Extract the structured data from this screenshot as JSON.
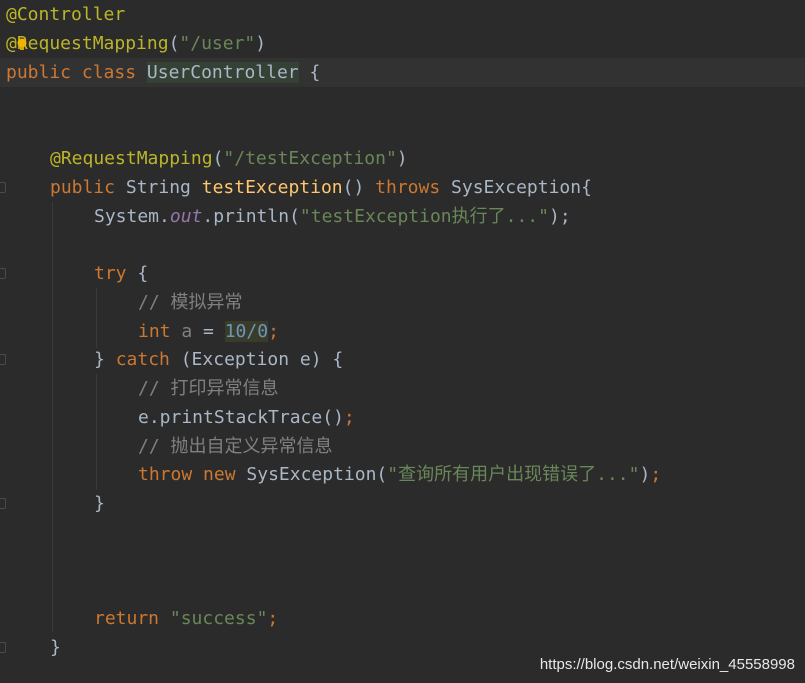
{
  "code": {
    "annotation_controller": "@Controller",
    "annotation_request_mapping_class": "@RequestMapping",
    "class_mapping_value": "\"/user\"",
    "kw_public": "public",
    "kw_class": "class",
    "class_name": "UserController",
    "open_brace": "{",
    "method_annotation": "@RequestMapping",
    "method_mapping_value": "\"/testException\"",
    "type_string": "String",
    "method_name": "testException",
    "method_parens": "()",
    "kw_throws": "throws",
    "exception_type_decl": "SysException{",
    "system_prefix": "System.",
    "field_out": "out",
    "println_call": ".println(",
    "println_string": "\"testException执行了...\"",
    "close_paren_semi": ");",
    "kw_try": "try",
    "comment_simulate": "// 模拟异常",
    "kw_int": "int",
    "var_a": "a",
    "assign": " = ",
    "div_expr": "10/0",
    "semicolon": ";",
    "close_brace": "}",
    "kw_catch": "catch",
    "catch_params": "(Exception e) {",
    "comment_print": "// 打印异常信息",
    "print_stack_trace": "e.printStackTrace()",
    "comment_throw": "// 抛出自定义异常信息",
    "kw_throw": "throw",
    "kw_new": "new",
    "sys_exception_ctor": "SysException(",
    "throw_message": "\"查询所有用户出现错误了...\"",
    "kw_return": "return",
    "return_value": "\"success\"",
    "method_close_brace": "}"
  },
  "watermark": "https://blog.csdn.net/weixin_45558998",
  "colors": {
    "background": "#2b2b2b",
    "keyword": "#cc7832",
    "annotation": "#bbb529",
    "string": "#6a8759",
    "method": "#ffc66d",
    "number": "#6897bb",
    "static_field": "#9876aa",
    "comment": "#808080",
    "default_text": "#a9b7c6"
  },
  "icons": [
    "intention-bulb-icon",
    "fold-marker-icon"
  ]
}
